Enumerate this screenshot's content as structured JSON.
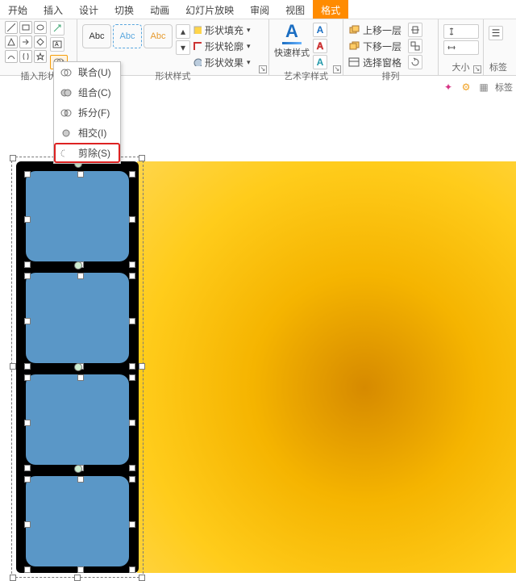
{
  "tabs": [
    "开始",
    "插入",
    "设计",
    "切换",
    "动画",
    "幻灯片放映",
    "审阅",
    "视图",
    "格式"
  ],
  "active_tab_index": 8,
  "groups": {
    "insert_shape": "插入形状",
    "shape_styles": "形状样式",
    "wordart_styles": "艺术字样式",
    "arrange": "排列",
    "size": "大小",
    "mark": "标签"
  },
  "shape_style": {
    "abc": "Abc",
    "fill": "形状填充",
    "outline": "形状轮廓",
    "effects": "形状效果"
  },
  "quick_styles": "快速样式",
  "wordart_tools": {
    "fill_a": "A",
    "outline_a": "A",
    "effects_a": "A"
  },
  "arrange": {
    "bring_forward": "上移一层",
    "send_backward": "下移一层",
    "selection_pane": "选择窗格"
  },
  "merge_menu": {
    "union": "联合(U)",
    "combine": "组合(C)",
    "fragment": "拆分(F)",
    "intersect": "相交(I)",
    "subtract": "剪除(S)"
  },
  "colors": {
    "accent": "#ff8b00",
    "shape_blue": "#5a97c7",
    "yellow_grad_inner": "#d68a00",
    "yellow_grad_outer": "#ffd54a",
    "highlight_red": "#d22"
  }
}
